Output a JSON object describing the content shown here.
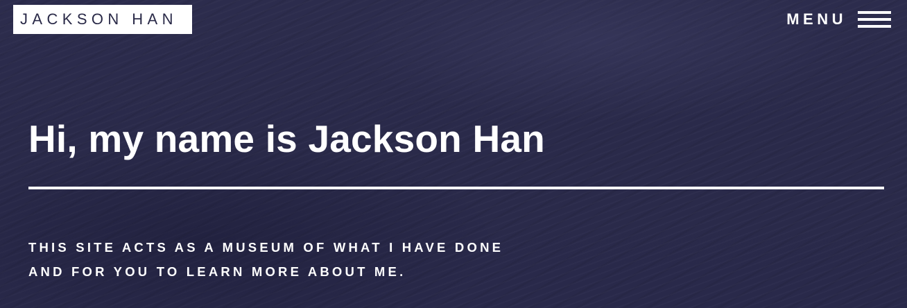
{
  "header": {
    "logo_text": "JACKSON HAN",
    "menu_label": "MENU",
    "menu_icon": "hamburger-icon"
  },
  "hero": {
    "title": "Hi, my name is Jackson Han",
    "tagline_lines": [
      "THIS SITE ACTS AS A MUSEUM OF WHAT I HAVE DONE",
      "AND FOR YOU TO LEARN MORE ABOUT ME."
    ]
  },
  "colors": {
    "background": "#2b2b4c",
    "text": "#ffffff",
    "logo_background": "#ffffff",
    "logo_text": "#2a2a48"
  }
}
